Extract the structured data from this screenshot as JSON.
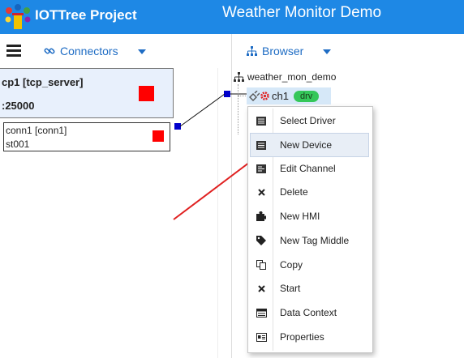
{
  "header": {
    "app_title": "IOTTree Project",
    "page_title": "Weather Monitor Demo",
    "bg_color": "#1e88e5"
  },
  "left_panel": {
    "menu_icon": "hamburger-icon",
    "tab_label": "Connectors",
    "tab_icon": "link-icon",
    "connector": {
      "name": "cp1 [tcp_server]",
      "port": ":25000"
    },
    "connection": {
      "name": "conn1 [conn1]",
      "sub": "st001"
    }
  },
  "right_panel": {
    "tab_label": "Browser",
    "tab_icon": "sitemap-icon",
    "tree": {
      "root_label": "weather_mon_demo",
      "channel_label": "ch1",
      "channel_badge": "drv",
      "badge_color": "#34c759"
    }
  },
  "context_menu": {
    "items": [
      {
        "label": "Select Driver",
        "icon": "list-icon"
      },
      {
        "label": "New Device",
        "icon": "list-icon"
      },
      {
        "label": "Edit Channel",
        "icon": "list-edit-icon"
      },
      {
        "label": "Delete",
        "icon": "close-icon"
      },
      {
        "label": "New HMI",
        "icon": "puzzle-icon"
      },
      {
        "label": "New Tag Middle",
        "icon": "tag-icon"
      },
      {
        "label": "Copy",
        "icon": "copy-icon"
      },
      {
        "label": "Start",
        "icon": "close-icon"
      },
      {
        "label": "Data Context",
        "icon": "panel-icon"
      },
      {
        "label": "Properties",
        "icon": "id-card-icon"
      }
    ],
    "highlighted_index": 1
  },
  "colors": {
    "accent": "#1e6cc4",
    "status_red": "#ff0000",
    "port_blue": "#0000cc",
    "arrow_red": "#e02020"
  }
}
